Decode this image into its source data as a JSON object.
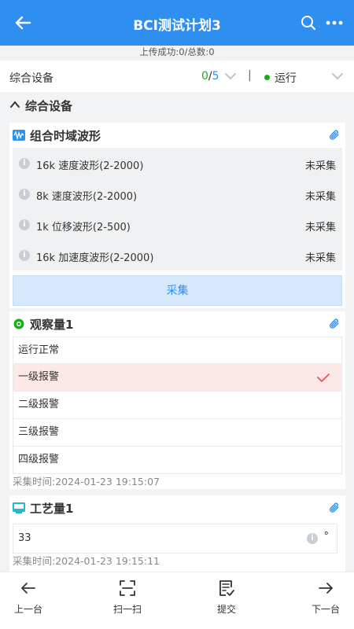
{
  "topbar": {
    "title": "BCI测试计划3"
  },
  "upload_status": "上传成功:0/总数:0",
  "device_row": {
    "label": "综合设备",
    "done": "0",
    "sep": "/",
    "total": "5",
    "divider": "|",
    "status": "运行",
    "status_color": "#1aad19"
  },
  "section": {
    "title": "综合设备"
  },
  "waveform": {
    "title": "组合时域波形",
    "items": [
      {
        "name": "16k 速度波形(2-2000)",
        "status": "未采集"
      },
      {
        "name": "8k 速度波形(2-2000)",
        "status": "未采集"
      },
      {
        "name": "1k 位移波形(2-500)",
        "status": "未采集"
      },
      {
        "name": "16k 加速度波形(2-2000)",
        "status": "未采集"
      }
    ],
    "collect_label": "采集"
  },
  "observation": {
    "title": "观察量1",
    "options": [
      "运行正常",
      "一级报警",
      "二级报警",
      "三级报警",
      "四级报警"
    ],
    "selected": "一级报警",
    "collect_time": "采集时间:2024-01-23 19:15:07"
  },
  "process": {
    "title": "工艺量1",
    "value": "33",
    "unit": "°",
    "collect_time": "采集时间:2024-01-23 19:15:11"
  },
  "bottom_nav": {
    "prev": "上一台",
    "scan": "扫一扫",
    "submit": "提交",
    "next": "下一台"
  },
  "colors": {
    "primary": "#2f8ff0",
    "ok": "#1aad19",
    "alarm_bg": "#fde8e8",
    "check": "#e85555"
  }
}
